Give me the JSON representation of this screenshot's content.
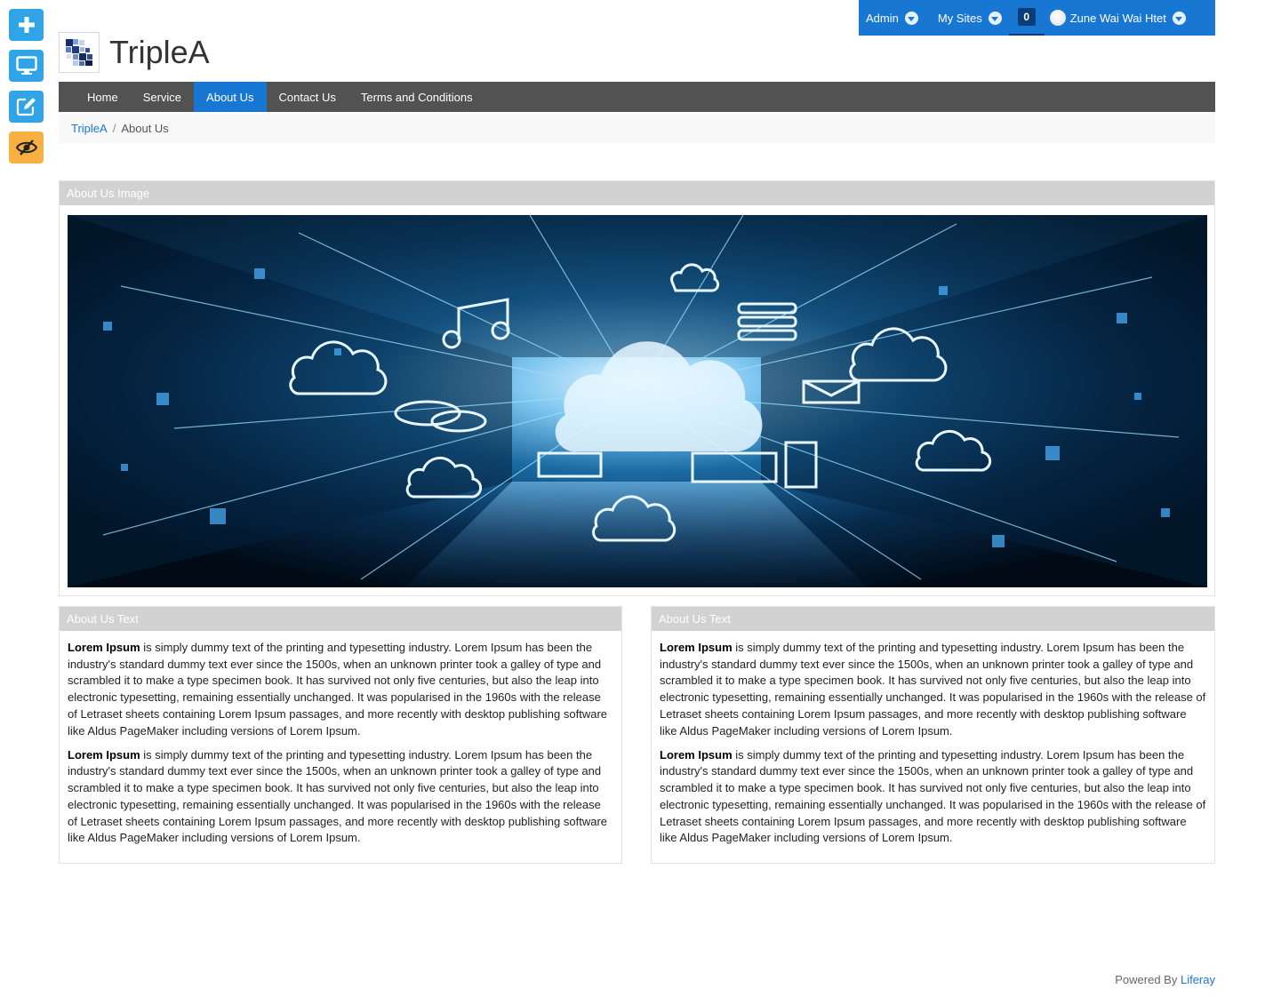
{
  "dockbar": {
    "buttons": [
      {
        "icon": "plus-icon",
        "color": "#2fa4e7"
      },
      {
        "icon": "monitor-icon",
        "color": "#2fa4e7"
      },
      {
        "icon": "edit-icon",
        "color": "#2fa4e7"
      },
      {
        "icon": "eye-slash-icon",
        "color": "#f8b140"
      }
    ]
  },
  "adminbar": {
    "admin_label": "Admin",
    "mysites_label": "My Sites",
    "notification_count": "0",
    "user_name": "Zune Wai Wai Htet",
    "color": "#1877d3"
  },
  "site": {
    "title": "TripleA"
  },
  "nav": {
    "items": [
      "Home",
      "Service",
      "About Us",
      "Contact Us",
      "Terms and Conditions"
    ],
    "active": "About Us"
  },
  "breadcrumb": {
    "root": "TripleA",
    "separator": "/",
    "current": "About Us"
  },
  "portlets": {
    "image": {
      "title": "About Us Image"
    },
    "text1": {
      "title": "About Us Text",
      "paragraphs": [
        {
          "lead": "Lorem Ipsum",
          "rest": " is simply dummy text of the printing and typesetting industry. Lorem Ipsum has been the industry's standard dummy text ever since the 1500s, when an unknown printer took a galley of type and scrambled it to make a type specimen book. It has survived not only five centuries, but also the leap into electronic typesetting, remaining essentially unchanged. It was popularised in the 1960s with the release of Letraset sheets containing Lorem Ipsum passages, and more recently with desktop publishing software like Aldus PageMaker including versions of Lorem Ipsum."
        },
        {
          "lead": "Lorem Ipsum",
          "rest": " is simply dummy text of the printing and typesetting industry. Lorem Ipsum has been the industry's standard dummy text ever since the 1500s, when an unknown printer took a galley of type and scrambled it to make a type specimen book. It has survived not only five centuries, but also the leap into electronic typesetting, remaining essentially unchanged. It was popularised in the 1960s with the release of Letraset sheets containing Lorem Ipsum passages, and more recently with desktop publishing software like Aldus PageMaker including versions of Lorem Ipsum."
        }
      ]
    },
    "text2": {
      "title": "About Us Text",
      "paragraphs": [
        {
          "lead": "Lorem Ipsum",
          "rest": " is simply dummy text of the printing and typesetting industry. Lorem Ipsum has been the industry's standard dummy text ever since the 1500s, when an unknown printer took a galley of type and scrambled it to make a type specimen book. It has survived not only five centuries, but also the leap into electronic typesetting, remaining essentially unchanged. It was popularised in the 1960s with the release of Letraset sheets containing Lorem Ipsum passages, and more recently with desktop publishing software like Aldus PageMaker including versions of Lorem Ipsum."
        },
        {
          "lead": "Lorem Ipsum",
          "rest": " is simply dummy text of the printing and typesetting industry. Lorem Ipsum has been the industry's standard dummy text ever since the 1500s, when an unknown printer took a galley of type and scrambled it to make a type specimen book. It has survived not only five centuries, but also the leap into electronic typesetting, remaining essentially unchanged. It was popularised in the 1960s with the release of Letraset sheets containing Lorem Ipsum passages, and more recently with desktop publishing software like Aldus PageMaker including versions of Lorem Ipsum."
        }
      ]
    }
  },
  "footer": {
    "prefix": "Powered By ",
    "link": "Liferay"
  }
}
